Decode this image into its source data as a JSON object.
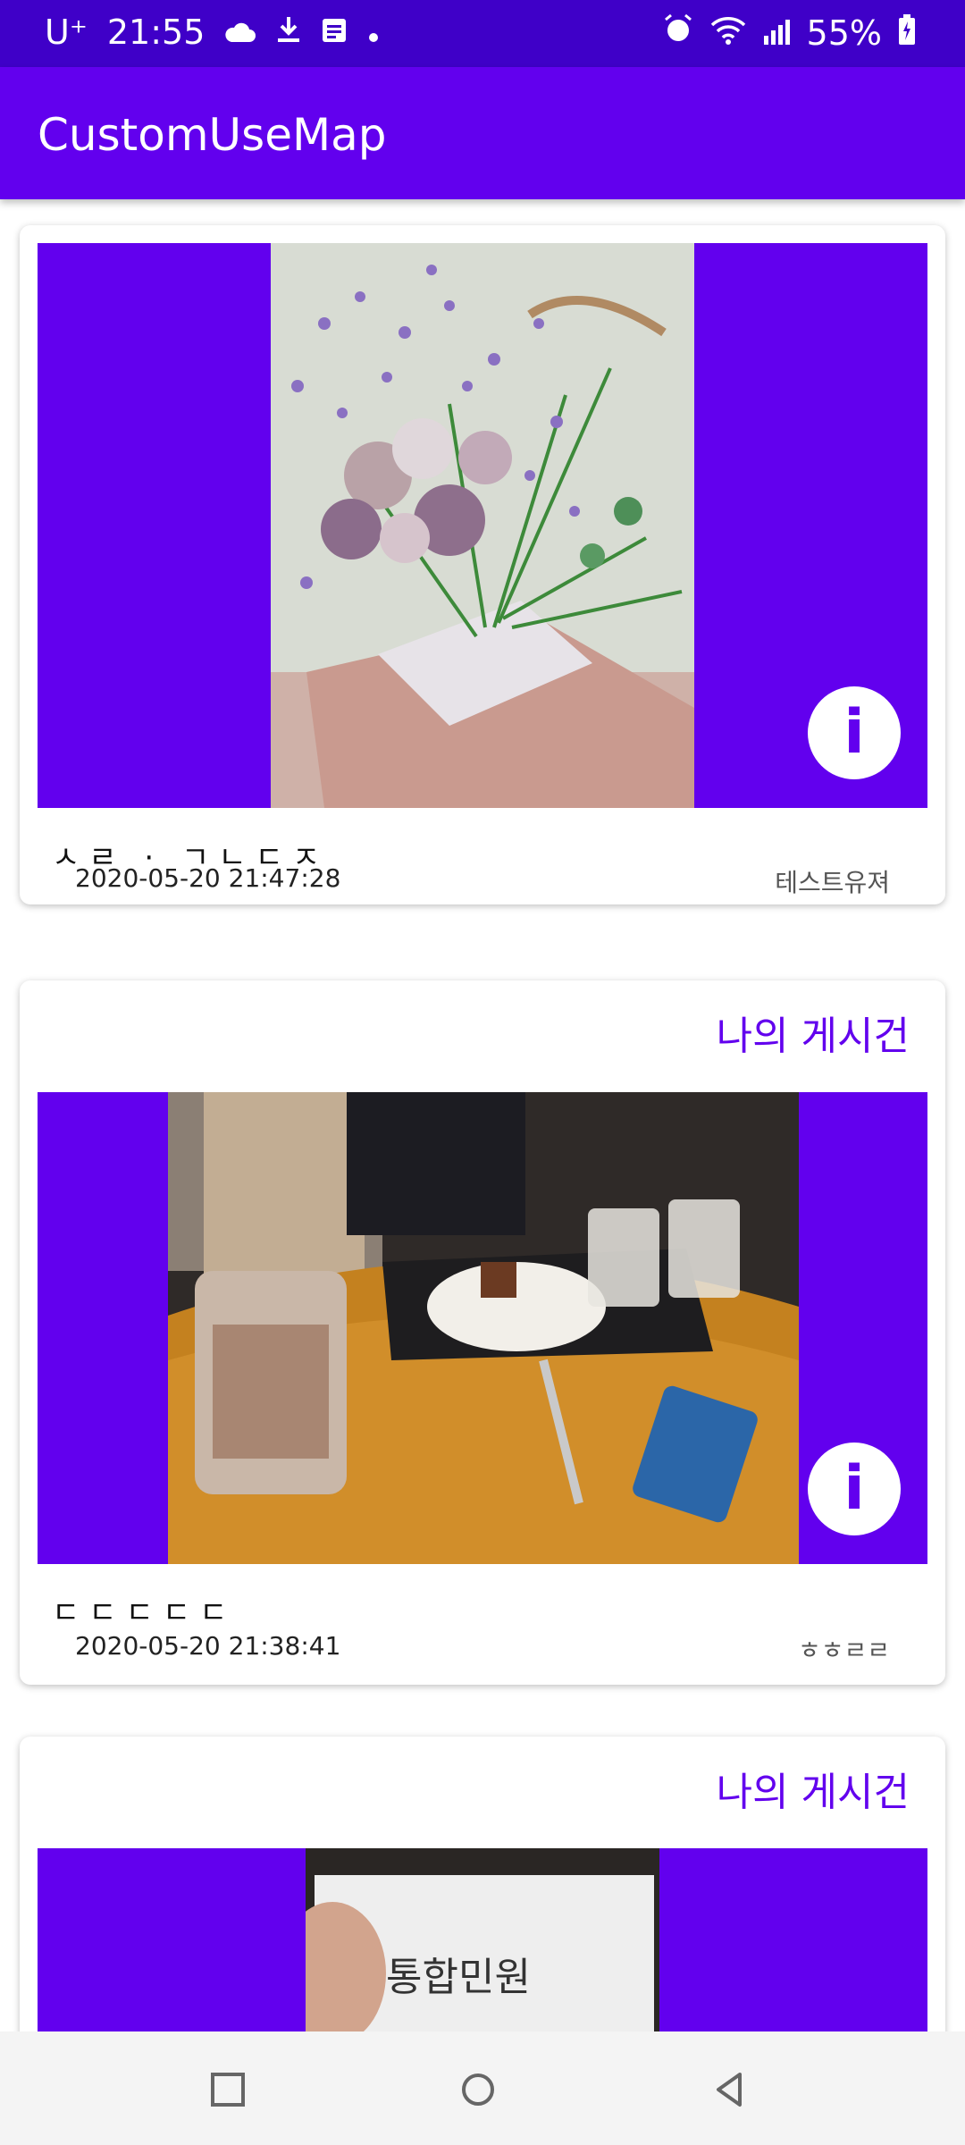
{
  "status_bar": {
    "carrier": "U⁺",
    "time": "21:55",
    "battery": "55%"
  },
  "app_bar": {
    "title": "CustomUseMap"
  },
  "posts": [
    {
      "badge": "",
      "title": "ㅅㄹ · ㄱㄴㄷㅈ",
      "date": "2020-05-20 21:47:28",
      "author": "테스트유져",
      "image": "flower-bouquet-photo"
    },
    {
      "badge": "나의 게시건",
      "title": "ㄷㄷㄷㄷㄷ",
      "date": "2020-05-20 21:38:41",
      "author": "ㅎㅎㄹㄹ",
      "image": "cafe-table-photo"
    },
    {
      "badge": "나의 게시건",
      "image": "receipt-photo",
      "image_text": "통합민원"
    }
  ],
  "colors": {
    "primary": "#6200ee",
    "status_bar": "#3f00c8"
  }
}
